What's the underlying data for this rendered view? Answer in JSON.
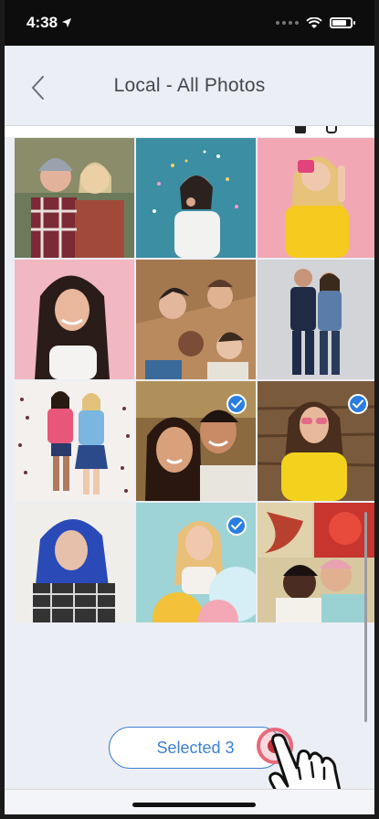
{
  "status_bar": {
    "time": "4:38",
    "location_icon": "location-arrow-icon",
    "signal_icon": "signal-dots-icon",
    "wifi_icon": "wifi-icon",
    "battery_icon": "battery-icon"
  },
  "nav": {
    "back_icon": "chevron-left-icon",
    "title": "Local - All Photos"
  },
  "photos": [
    {
      "name": "photo-two-friends-hats",
      "selected": false
    },
    {
      "name": "photo-woman-blowing-glitter",
      "selected": false
    },
    {
      "name": "photo-woman-pink-camera",
      "selected": false
    },
    {
      "name": "photo-girl-smiling-pink",
      "selected": false
    },
    {
      "name": "photo-friends-lying-circle",
      "selected": false
    },
    {
      "name": "photo-couple-standing",
      "selected": false
    },
    {
      "name": "photo-two-girls-backpacks",
      "selected": false
    },
    {
      "name": "photo-couple-selfie",
      "selected": true
    },
    {
      "name": "photo-woman-sunglasses-yellow",
      "selected": true
    },
    {
      "name": "photo-woman-blue-hair",
      "selected": false
    },
    {
      "name": "photo-woman-balloons",
      "selected": true
    },
    {
      "name": "photo-couple-flowers",
      "selected": false
    }
  ],
  "selection_button": {
    "label": "Selected 3"
  },
  "colors": {
    "accent": "#3d7fd1",
    "check": "#2a7de1",
    "tap": "#e8687a"
  }
}
